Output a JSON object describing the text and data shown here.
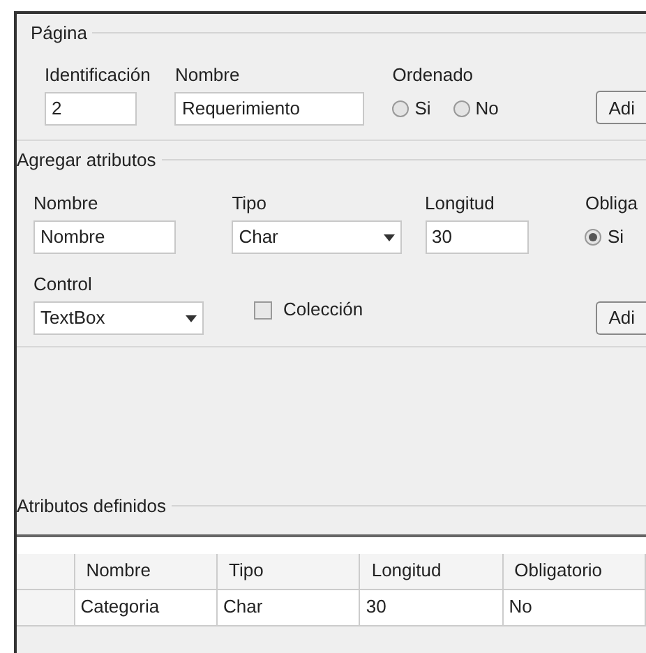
{
  "page_group": {
    "title": "Página",
    "id_label": "Identificación",
    "id_value": "2",
    "name_label": "Nombre",
    "name_value": "Requerimiento",
    "ordered_label": "Ordenado",
    "ordered_options": [
      {
        "label": "Si",
        "selected": false
      },
      {
        "label": "No",
        "selected": false
      }
    ],
    "add_button": "Adi"
  },
  "attributes_group": {
    "title": "Agregar atributos",
    "name_label": "Nombre",
    "name_value": "Nombre",
    "type_label": "Tipo",
    "type_value": "Char",
    "length_label": "Longitud",
    "length_value": "30",
    "required_label": "Obliga",
    "required_options": [
      {
        "label": "Si",
        "selected": true
      }
    ],
    "control_label": "Control",
    "control_value": "TextBox",
    "collection": {
      "label": "Colección",
      "checked": false
    },
    "add_button": "Adi"
  },
  "defined_group": {
    "title": "Atributos definidos",
    "table": {
      "columns": [
        "Nombre",
        "Tipo",
        "Longitud",
        "Obligatorio"
      ],
      "rows": [
        {
          "cells": [
            "Categoria",
            "Char",
            "30",
            "No"
          ]
        }
      ]
    }
  }
}
